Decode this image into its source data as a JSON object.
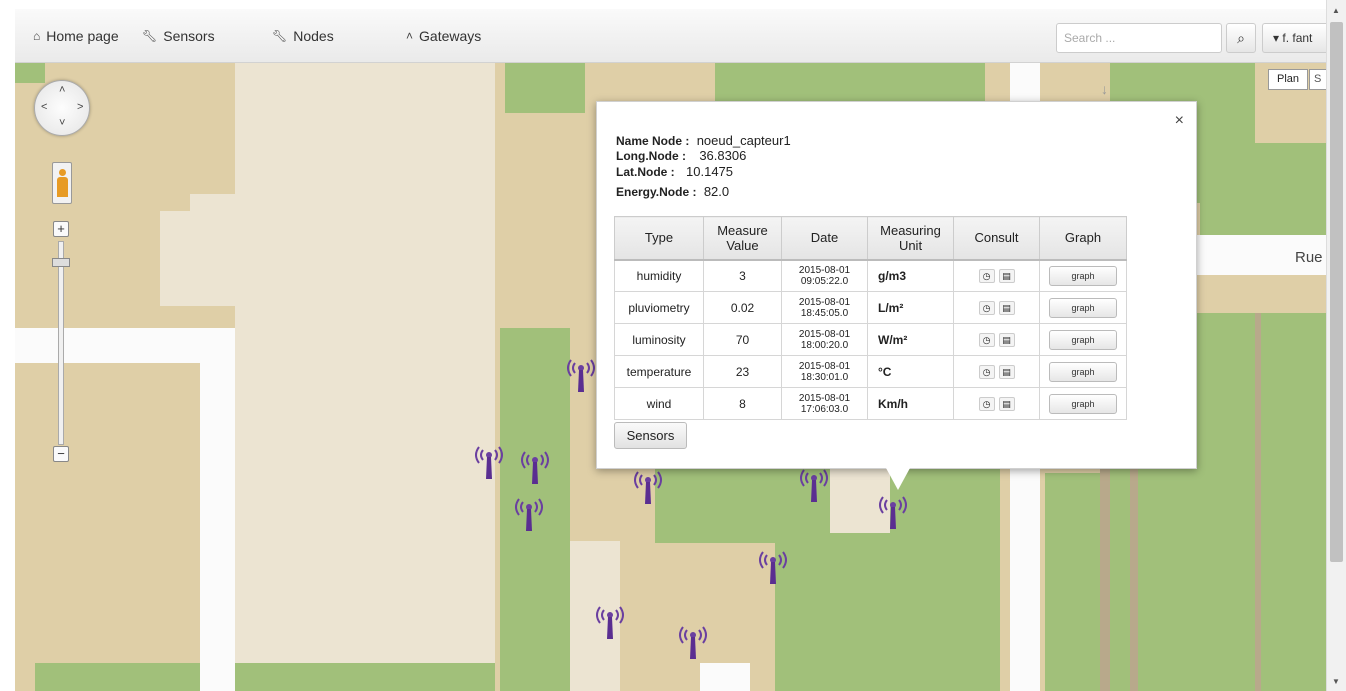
{
  "navbar": {
    "home_label": "Home page",
    "sensors_label": "Sensors",
    "nodes_label": "Nodes",
    "gateways_label": "Gateways",
    "search_placeholder": "Search ...",
    "user_label": "f. fant"
  },
  "map": {
    "plan_label": "Plan",
    "satellite_label": "S",
    "street_label": "Rue H",
    "zoom_in": "+",
    "zoom_out": "−"
  },
  "popup": {
    "name_label": "Name Node :",
    "name_value": "noeud_capteur1",
    "long_label": "Long.Node :",
    "long_value": "36.8306",
    "lat_label": "Lat.Node :",
    "lat_value": "10.1475",
    "energy_label": "Energy.Node :",
    "energy_value": "82.0",
    "close": "×",
    "columns": [
      "Type",
      "Measure Value",
      "Date",
      "Measuring Unit",
      "Consult",
      "Graph"
    ],
    "rows": [
      {
        "type": "humidity",
        "value": "3",
        "date_day": "2015-08-01",
        "date_time": "09:05:22.0",
        "unit": "g/m3",
        "graph": "graph"
      },
      {
        "type": "pluviometry",
        "value": "0.02",
        "date_day": "2015-08-01",
        "date_time": "18:45:05.0",
        "unit": "L/m²",
        "graph": "graph"
      },
      {
        "type": "luminosity",
        "value": "70",
        "date_day": "2015-08-01",
        "date_time": "18:00:20.0",
        "unit": "W/m²",
        "graph": "graph"
      },
      {
        "type": "temperature",
        "value": "23",
        "date_day": "2015-08-01",
        "date_time": "18:30:01.0",
        "unit": "°C",
        "graph": "graph"
      },
      {
        "type": "wind",
        "value": "8",
        "date_day": "2015-08-01",
        "date_time": "17:06:03.0",
        "unit": "Km/h",
        "graph": "graph"
      }
    ],
    "sensors_button": "Sensors"
  }
}
